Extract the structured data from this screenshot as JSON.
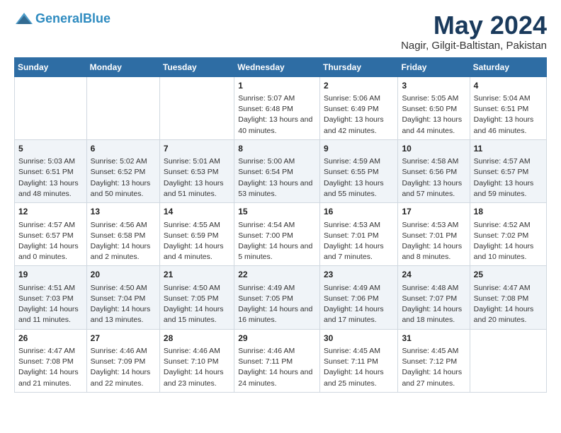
{
  "logo": {
    "line1": "General",
    "line2": "Blue"
  },
  "title": "May 2024",
  "subtitle": "Nagir, Gilgit-Baltistan, Pakistan",
  "days_of_week": [
    "Sunday",
    "Monday",
    "Tuesday",
    "Wednesday",
    "Thursday",
    "Friday",
    "Saturday"
  ],
  "weeks": [
    [
      {
        "day": "",
        "content": ""
      },
      {
        "day": "",
        "content": ""
      },
      {
        "day": "",
        "content": ""
      },
      {
        "day": "1",
        "content": "Sunrise: 5:07 AM\nSunset: 6:48 PM\nDaylight: 13 hours\nand 40 minutes."
      },
      {
        "day": "2",
        "content": "Sunrise: 5:06 AM\nSunset: 6:49 PM\nDaylight: 13 hours\nand 42 minutes."
      },
      {
        "day": "3",
        "content": "Sunrise: 5:05 AM\nSunset: 6:50 PM\nDaylight: 13 hours\nand 44 minutes."
      },
      {
        "day": "4",
        "content": "Sunrise: 5:04 AM\nSunset: 6:51 PM\nDaylight: 13 hours\nand 46 minutes."
      }
    ],
    [
      {
        "day": "5",
        "content": "Sunrise: 5:03 AM\nSunset: 6:51 PM\nDaylight: 13 hours\nand 48 minutes."
      },
      {
        "day": "6",
        "content": "Sunrise: 5:02 AM\nSunset: 6:52 PM\nDaylight: 13 hours\nand 50 minutes."
      },
      {
        "day": "7",
        "content": "Sunrise: 5:01 AM\nSunset: 6:53 PM\nDaylight: 13 hours\nand 51 minutes."
      },
      {
        "day": "8",
        "content": "Sunrise: 5:00 AM\nSunset: 6:54 PM\nDaylight: 13 hours\nand 53 minutes."
      },
      {
        "day": "9",
        "content": "Sunrise: 4:59 AM\nSunset: 6:55 PM\nDaylight: 13 hours\nand 55 minutes."
      },
      {
        "day": "10",
        "content": "Sunrise: 4:58 AM\nSunset: 6:56 PM\nDaylight: 13 hours\nand 57 minutes."
      },
      {
        "day": "11",
        "content": "Sunrise: 4:57 AM\nSunset: 6:57 PM\nDaylight: 13 hours\nand 59 minutes."
      }
    ],
    [
      {
        "day": "12",
        "content": "Sunrise: 4:57 AM\nSunset: 6:57 PM\nDaylight: 14 hours\nand 0 minutes."
      },
      {
        "day": "13",
        "content": "Sunrise: 4:56 AM\nSunset: 6:58 PM\nDaylight: 14 hours\nand 2 minutes."
      },
      {
        "day": "14",
        "content": "Sunrise: 4:55 AM\nSunset: 6:59 PM\nDaylight: 14 hours\nand 4 minutes."
      },
      {
        "day": "15",
        "content": "Sunrise: 4:54 AM\nSunset: 7:00 PM\nDaylight: 14 hours\nand 5 minutes."
      },
      {
        "day": "16",
        "content": "Sunrise: 4:53 AM\nSunset: 7:01 PM\nDaylight: 14 hours\nand 7 minutes."
      },
      {
        "day": "17",
        "content": "Sunrise: 4:53 AM\nSunset: 7:01 PM\nDaylight: 14 hours\nand 8 minutes."
      },
      {
        "day": "18",
        "content": "Sunrise: 4:52 AM\nSunset: 7:02 PM\nDaylight: 14 hours\nand 10 minutes."
      }
    ],
    [
      {
        "day": "19",
        "content": "Sunrise: 4:51 AM\nSunset: 7:03 PM\nDaylight: 14 hours\nand 11 minutes."
      },
      {
        "day": "20",
        "content": "Sunrise: 4:50 AM\nSunset: 7:04 PM\nDaylight: 14 hours\nand 13 minutes."
      },
      {
        "day": "21",
        "content": "Sunrise: 4:50 AM\nSunset: 7:05 PM\nDaylight: 14 hours\nand 15 minutes."
      },
      {
        "day": "22",
        "content": "Sunrise: 4:49 AM\nSunset: 7:05 PM\nDaylight: 14 hours\nand 16 minutes."
      },
      {
        "day": "23",
        "content": "Sunrise: 4:49 AM\nSunset: 7:06 PM\nDaylight: 14 hours\nand 17 minutes."
      },
      {
        "day": "24",
        "content": "Sunrise: 4:48 AM\nSunset: 7:07 PM\nDaylight: 14 hours\nand 18 minutes."
      },
      {
        "day": "25",
        "content": "Sunrise: 4:47 AM\nSunset: 7:08 PM\nDaylight: 14 hours\nand 20 minutes."
      }
    ],
    [
      {
        "day": "26",
        "content": "Sunrise: 4:47 AM\nSunset: 7:08 PM\nDaylight: 14 hours\nand 21 minutes."
      },
      {
        "day": "27",
        "content": "Sunrise: 4:46 AM\nSunset: 7:09 PM\nDaylight: 14 hours\nand 22 minutes."
      },
      {
        "day": "28",
        "content": "Sunrise: 4:46 AM\nSunset: 7:10 PM\nDaylight: 14 hours\nand 23 minutes."
      },
      {
        "day": "29",
        "content": "Sunrise: 4:46 AM\nSunset: 7:11 PM\nDaylight: 14 hours\nand 24 minutes."
      },
      {
        "day": "30",
        "content": "Sunrise: 4:45 AM\nSunset: 7:11 PM\nDaylight: 14 hours\nand 25 minutes."
      },
      {
        "day": "31",
        "content": "Sunrise: 4:45 AM\nSunset: 7:12 PM\nDaylight: 14 hours\nand 27 minutes."
      },
      {
        "day": "",
        "content": ""
      }
    ]
  ]
}
